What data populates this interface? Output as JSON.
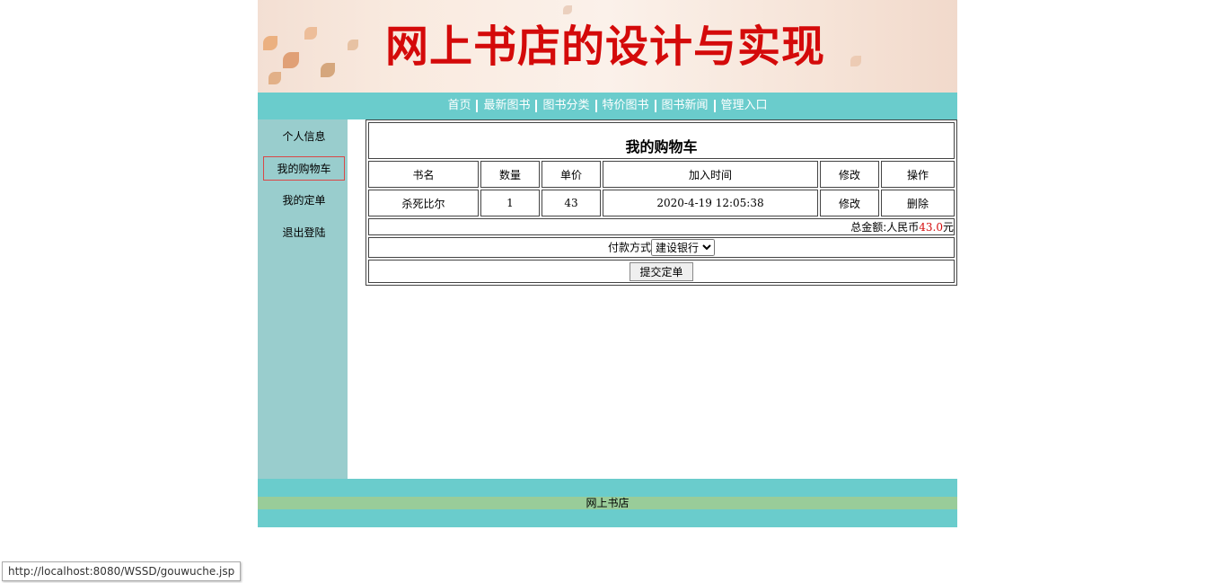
{
  "banner": {
    "title": "网上书店的设计与实现"
  },
  "nav": {
    "items": [
      {
        "label": "首页"
      },
      {
        "label": "最新图书"
      },
      {
        "label": "图书分类"
      },
      {
        "label": "特价图书"
      },
      {
        "label": "图书新闻"
      },
      {
        "label": "管理入口"
      }
    ]
  },
  "sidebar": {
    "items": [
      {
        "label": "个人信息"
      },
      {
        "label": "我的购物车",
        "active": true
      },
      {
        "label": "我的定单"
      },
      {
        "label": "退出登陆"
      }
    ]
  },
  "cart": {
    "title": "我的购物车",
    "columns": [
      "书名",
      "数量",
      "单价",
      "加入时间",
      "修改",
      "操作"
    ],
    "rows": [
      {
        "name": "杀死比尔",
        "qty": "1",
        "price": "43",
        "time": "2020-4-19 12:05:38",
        "edit": "修改",
        "del": "删除"
      }
    ],
    "total_prefix": "总金额:人民币",
    "total_amount": "43.0",
    "total_suffix": "元",
    "payment_label": "付款方式",
    "payment_selected": "建设银行",
    "submit_label": "提交定单"
  },
  "footer": {
    "text": "网上书店"
  },
  "status_url": "http://localhost:8080/WSSD/gouwuche.jsp",
  "colors": {
    "nav_bg": "#6acccc",
    "sidebar_bg": "#99cdcd",
    "footer_band": "#99cc99",
    "banner_title": "#d40a0a"
  }
}
